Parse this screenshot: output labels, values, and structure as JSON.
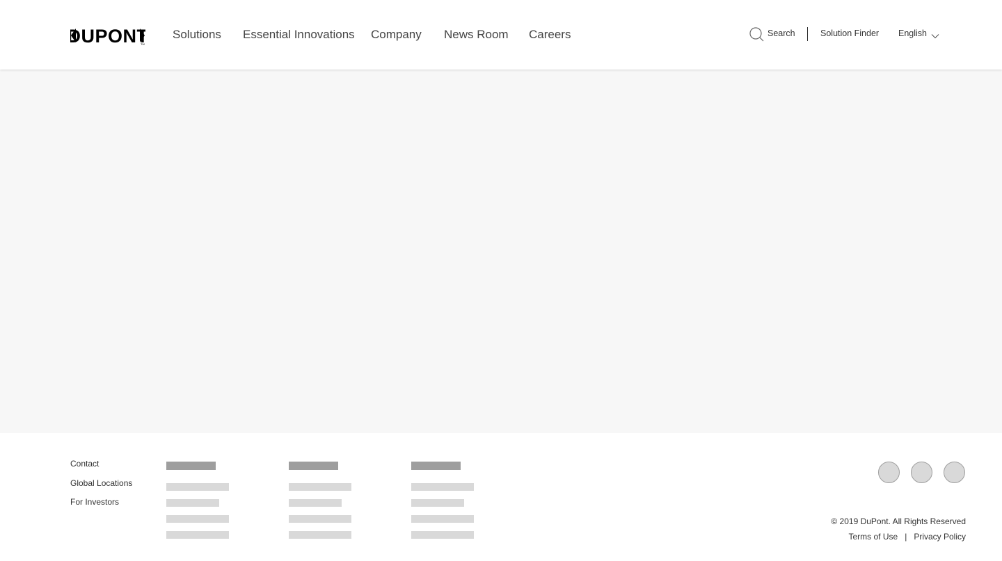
{
  "header": {
    "logo_text": "DUPONT",
    "nav": [
      {
        "label": "Solutions"
      },
      {
        "label": "Essential Innovations"
      },
      {
        "label": "Company"
      },
      {
        "label": "News Room"
      },
      {
        "label": "Careers"
      }
    ],
    "search_label": "Search",
    "solution_finder_label": "Solution Finder",
    "language_selected": "English"
  },
  "footer": {
    "links": [
      "Contact",
      "Global Locations",
      "For Investors"
    ],
    "copyright": "© 2019 DuPont. All Rights Reserved",
    "terms_label": "Terms of Use",
    "privacy_label": "Privacy Policy"
  },
  "icons": {
    "search": "search-icon",
    "chevron": "chevron-down-icon",
    "social": [
      "social-icon",
      "social-icon",
      "social-icon"
    ]
  },
  "colors": {
    "brand": "#000000",
    "main_bg": "#f7f7f7",
    "placeholder_dark": "#9e9e9e",
    "placeholder_light": "#d9d9d9"
  }
}
